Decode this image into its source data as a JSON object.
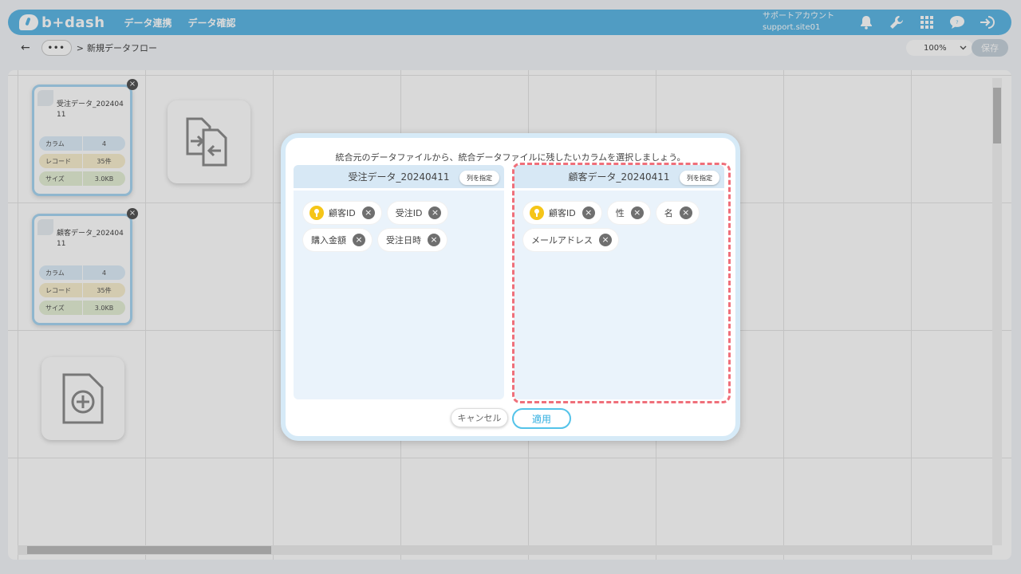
{
  "header": {
    "brand": "b+dash",
    "nav": [
      "データ連携",
      "データ確認"
    ],
    "account_label": "サポートアカウント",
    "account_id": "support.site01",
    "icons": [
      "bell-icon",
      "wrench-icon",
      "grid-icon",
      "chat-icon",
      "logout-icon"
    ]
  },
  "subbar": {
    "back": "←",
    "more": "•••",
    "separator": ">",
    "breadcrumb": "新規データフロー",
    "zoom": "100%",
    "save": "保存"
  },
  "nodes": [
    {
      "title": "受注データ_20240411",
      "rows": [
        {
          "label": "カラム",
          "value": "4"
        },
        {
          "label": "レコード",
          "value": "35件"
        },
        {
          "label": "サイズ",
          "value": "3.0KB"
        }
      ]
    },
    {
      "title": "顧客データ_20240411",
      "rows": [
        {
          "label": "カラム",
          "value": "4"
        },
        {
          "label": "レコード",
          "value": "35件"
        },
        {
          "label": "サイズ",
          "value": "3.0KB"
        }
      ]
    }
  ],
  "modal": {
    "message": "統合元のデータファイルから、統合データファイルに残したいカラムを選択しましょう。",
    "left": {
      "title": "受注データ_20240411",
      "spec_button": "列を指定",
      "columns": [
        {
          "name": "顧客ID",
          "key": true
        },
        {
          "name": "受注ID",
          "key": false
        },
        {
          "name": "購入金額",
          "key": false
        },
        {
          "name": "受注日時",
          "key": false
        }
      ]
    },
    "right": {
      "title": "顧客データ_20240411",
      "spec_button": "列を指定",
      "columns": [
        {
          "name": "顧客ID",
          "key": true
        },
        {
          "name": "性",
          "key": false
        },
        {
          "name": "名",
          "key": false
        },
        {
          "name": "メールアドレス",
          "key": false
        }
      ]
    },
    "cancel": "キャンセル",
    "apply": "適用"
  },
  "colors": {
    "accent": "#5fb8e6",
    "highlight": "#ef6f7a",
    "key": "#f5c518"
  }
}
